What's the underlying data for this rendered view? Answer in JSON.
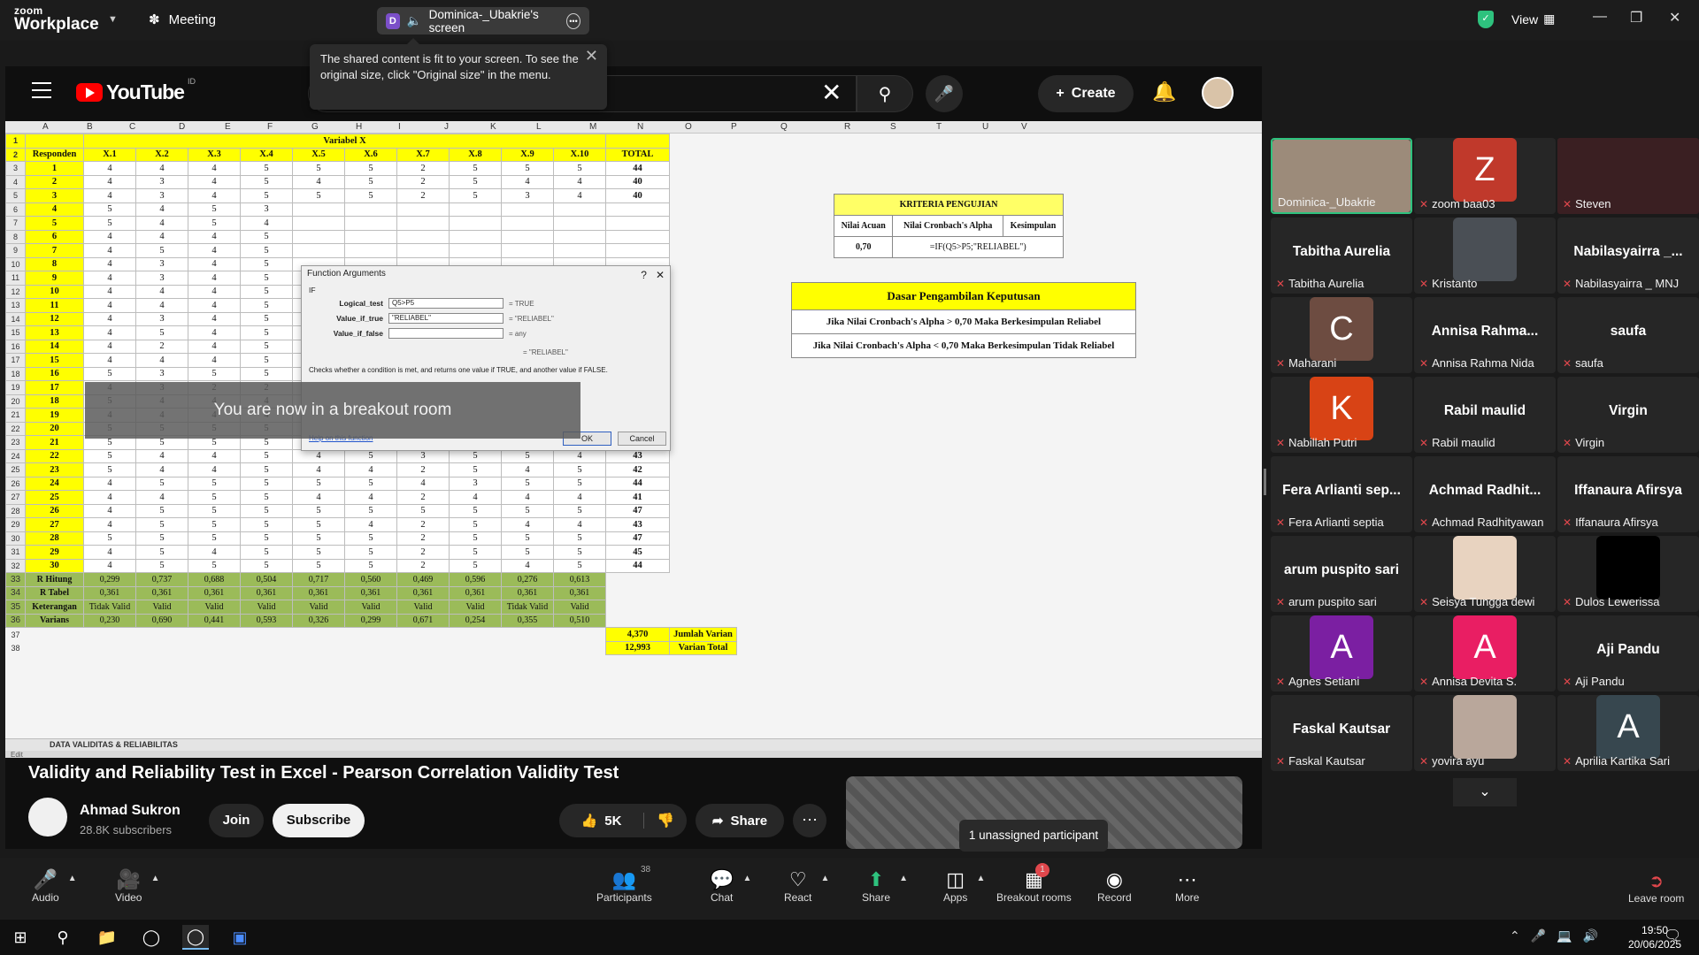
{
  "zoom": {
    "logo_top": "zoom",
    "logo_bottom": "Workplace",
    "meeting_label": "Meeting",
    "screen_pill_initial": "D",
    "screen_pill_label": "Dominica-_Ubakrie's screen",
    "tooltip_text": "The shared content is fit to your screen. To see the original size, click \"Original size\" in the menu.",
    "view_label": "View",
    "breakout_toast": "You are now in a breakout room",
    "unassigned": "1 unassigned participant"
  },
  "youtube": {
    "logo_text": "YouTube",
    "logo_region": "ID",
    "search_value": "uji validitas dan reliabilitas dengan excel",
    "create_label": "Create",
    "video_title": "Validity and Reliability Test in Excel - Pearson Correlation Validity Test",
    "channel_name": "Ahmad Sukron",
    "channel_subs": "28.8K subscribers",
    "join_label": "Join",
    "subscribe_label": "Subscribe",
    "likes": "5K",
    "share_label": "Share"
  },
  "sheet": {
    "columns": [
      "A",
      "B",
      "C",
      "D",
      "E",
      "F",
      "G",
      "H",
      "I",
      "J",
      "K",
      "L",
      "M",
      "N",
      "O",
      "P",
      "Q",
      "R",
      "S",
      "T",
      "U",
      "V"
    ],
    "variabel_header": "Variabel X",
    "headers": [
      "Responden",
      "X.1",
      "X.2",
      "X.3",
      "X.4",
      "X.5",
      "X.6",
      "X.7",
      "X.8",
      "X.9",
      "X.10",
      "TOTAL"
    ],
    "rows": [
      [
        "1",
        "4",
        "4",
        "4",
        "5",
        "5",
        "5",
        "2",
        "5",
        "5",
        "5",
        "44"
      ],
      [
        "2",
        "4",
        "3",
        "4",
        "5",
        "4",
        "5",
        "2",
        "5",
        "4",
        "4",
        "40"
      ],
      [
        "3",
        "4",
        "3",
        "4",
        "5",
        "5",
        "5",
        "2",
        "5",
        "3",
        "4",
        "40"
      ],
      [
        "4",
        "5",
        "4",
        "5",
        "3",
        "",
        "",
        "",
        "",
        "",
        "",
        ""
      ],
      [
        "5",
        "5",
        "4",
        "5",
        "4",
        "",
        "",
        "",
        "",
        "",
        "",
        ""
      ],
      [
        "6",
        "4",
        "4",
        "4",
        "5",
        "",
        "",
        "",
        "",
        "",
        "",
        ""
      ],
      [
        "7",
        "4",
        "5",
        "4",
        "5",
        "",
        "",
        "",
        "",
        "",
        "",
        ""
      ],
      [
        "8",
        "4",
        "3",
        "4",
        "5",
        "",
        "",
        "",
        "",
        "",
        "",
        ""
      ],
      [
        "9",
        "4",
        "3",
        "4",
        "5",
        "",
        "",
        "",
        "",
        "",
        "",
        ""
      ],
      [
        "10",
        "4",
        "4",
        "4",
        "5",
        "",
        "",
        "",
        "",
        "",
        "",
        ""
      ],
      [
        "11",
        "4",
        "4",
        "4",
        "5",
        "",
        "",
        "",
        "",
        "",
        "",
        ""
      ],
      [
        "12",
        "4",
        "3",
        "4",
        "5",
        "",
        "",
        "",
        "",
        "",
        "",
        ""
      ],
      [
        "13",
        "4",
        "5",
        "4",
        "5",
        "",
        "",
        "",
        "",
        "",
        "",
        ""
      ],
      [
        "14",
        "4",
        "2",
        "4",
        "5",
        "",
        "",
        "",
        "",
        "",
        "",
        ""
      ],
      [
        "15",
        "4",
        "4",
        "4",
        "5",
        "",
        "",
        "",
        "",
        "",
        "",
        ""
      ],
      [
        "16",
        "5",
        "3",
        "5",
        "5",
        "",
        "",
        "",
        "",
        "",
        "",
        ""
      ],
      [
        "17",
        "4",
        "3",
        "2",
        "2",
        "3",
        "4",
        "2",
        "4",
        "4",
        "2",
        "30"
      ],
      [
        "18",
        "5",
        "4",
        "4",
        "4",
        "4",
        "4",
        "2",
        "4",
        "4",
        "4",
        "39"
      ],
      [
        "19",
        "4",
        "4",
        "4",
        "4",
        "4",
        "3",
        "2",
        "4",
        "4",
        "5",
        "38"
      ],
      [
        "20",
        "5",
        "5",
        "5",
        "5",
        "5",
        "5",
        "4",
        "5",
        "4",
        "5",
        "44"
      ],
      [
        "21",
        "5",
        "5",
        "5",
        "5",
        "4",
        "5",
        "4",
        "5",
        "4",
        "5",
        "45"
      ],
      [
        "22",
        "5",
        "4",
        "4",
        "5",
        "4",
        "5",
        "3",
        "5",
        "5",
        "4",
        "43"
      ],
      [
        "23",
        "5",
        "4",
        "4",
        "5",
        "4",
        "4",
        "2",
        "5",
        "4",
        "5",
        "42"
      ],
      [
        "24",
        "4",
        "5",
        "5",
        "5",
        "5",
        "5",
        "4",
        "3",
        "5",
        "5",
        "44"
      ],
      [
        "25",
        "4",
        "4",
        "5",
        "5",
        "4",
        "4",
        "2",
        "4",
        "4",
        "4",
        "41"
      ],
      [
        "26",
        "4",
        "5",
        "5",
        "5",
        "5",
        "5",
        "5",
        "5",
        "5",
        "5",
        "47"
      ],
      [
        "27",
        "4",
        "5",
        "5",
        "5",
        "5",
        "4",
        "2",
        "5",
        "4",
        "4",
        "43"
      ],
      [
        "28",
        "5",
        "5",
        "5",
        "5",
        "5",
        "5",
        "2",
        "5",
        "5",
        "5",
        "47"
      ],
      [
        "29",
        "4",
        "5",
        "4",
        "5",
        "5",
        "5",
        "2",
        "5",
        "5",
        "5",
        "45"
      ],
      [
        "30",
        "4",
        "5",
        "5",
        "5",
        "5",
        "5",
        "2",
        "5",
        "4",
        "5",
        "44"
      ]
    ],
    "stats": [
      [
        "R Hitung",
        "0,299",
        "0,737",
        "0,688",
        "0,504",
        "0,717",
        "0,560",
        "0,469",
        "0,596",
        "0,276",
        "0,613"
      ],
      [
        "R Tabel",
        "0,361",
        "0,361",
        "0,361",
        "0,361",
        "0,361",
        "0,361",
        "0,361",
        "0,361",
        "0,361",
        "0,361"
      ],
      [
        "Keterangan",
        "Tidak Valid",
        "Valid",
        "Valid",
        "Valid",
        "Valid",
        "Valid",
        "Valid",
        "Valid",
        "Tidak Valid",
        "Valid"
      ],
      [
        "Varians",
        "0,230",
        "0,690",
        "0,441",
        "0,593",
        "0,326",
        "0,299",
        "0,671",
        "0,254",
        "0,355",
        "0,510"
      ]
    ],
    "jumlah_varian_value": "4,370",
    "jumlah_varian_label": "Jumlah Varian",
    "varian_total_value": "12,993",
    "varian_total_label": "Varian Total",
    "kriteria_title": "KRITERIA PENGUJIAN",
    "kriteria_headers": [
      "Nilai Acuan",
      "Nilai Cronbach's Alpha",
      "Kesimpulan"
    ],
    "kriteria_acuan": "0,70",
    "kriteria_formula": "=IF(Q5>P5;\"RELIABEL\")",
    "dasar_title": "Dasar Pengambilan Keputusan",
    "dasar_rule1": "Jika Nilai Cronbach's Alpha > 0,70 Maka Berkesimpulan Reliabel",
    "dasar_rule2": "Jika Nilai Cronbach's Alpha < 0,70 Maka Berkesimpulan Tidak Reliabel",
    "tab_name": "DATA VALIDITAS & RELIABILITAS",
    "status_text": "Edit"
  },
  "fn_dialog": {
    "title": "Function Arguments",
    "func": "IF",
    "logical_label": "Logical_test",
    "logical_value": "Q5>P5",
    "logical_result": "= TRUE",
    "true_label": "Value_if_true",
    "true_value": "\"RELIABEL\"",
    "true_result": "= \"RELIABEL\"",
    "false_label": "Value_if_false",
    "false_value": "",
    "false_result": "= any",
    "total_result": "= \"RELIABEL\"",
    "description": "Checks whether a condition is met, and returns one value if TRUE, and another value if FALSE.",
    "help_link": "Help on this function",
    "ok_label": "OK",
    "cancel_label": "Cancel"
  },
  "participants": [
    {
      "name": "Dominica-_Ubakrie",
      "display": "",
      "kind": "video",
      "color": "#9c8b7a",
      "active": true
    },
    {
      "name": "zoom baa03",
      "display": "",
      "kind": "avatar",
      "letter": "Z",
      "color": "#c0392b"
    },
    {
      "name": "Steven",
      "display": "",
      "kind": "video",
      "color": "#3a1f22"
    },
    {
      "name": "Tabitha Aurelia",
      "display": "Tabitha Aurelia",
      "kind": "name"
    },
    {
      "name": "Kristanto",
      "display": "",
      "kind": "photo",
      "color": "#4a4f55"
    },
    {
      "name": "Nabilasyairra _ MNJ",
      "display": "Nabilasyairra _...",
      "kind": "name"
    },
    {
      "name": "Maharani",
      "display": "",
      "kind": "avatar",
      "letter": "C",
      "color": "#6d4c41"
    },
    {
      "name": "Annisa Rahma Nida",
      "display": "Annisa Rahma...",
      "kind": "name"
    },
    {
      "name": "saufa",
      "display": "saufa",
      "kind": "name"
    },
    {
      "name": "Nabillah Putri",
      "display": "",
      "kind": "avatar",
      "letter": "K",
      "color": "#d84315"
    },
    {
      "name": "Rabil maulid",
      "display": "Rabil maulid",
      "kind": "name"
    },
    {
      "name": "Virgin",
      "display": "Virgin",
      "kind": "name"
    },
    {
      "name": "Fera Arlianti septia",
      "display": "Fera Arlianti sep...",
      "kind": "name"
    },
    {
      "name": "Achmad Radhityawan",
      "display": "Achmad Radhit...",
      "kind": "name"
    },
    {
      "name": "Iffanaura Afirsya",
      "display": "Iffanaura Afirsya",
      "kind": "name"
    },
    {
      "name": "arum puspito sari",
      "display": "arum puspito sari",
      "kind": "name"
    },
    {
      "name": "Seisya Tungga dewi",
      "display": "",
      "kind": "photo",
      "color": "#e8d3c0"
    },
    {
      "name": "Dulos Lewerissa",
      "display": "",
      "kind": "photo",
      "color": "#000000"
    },
    {
      "name": "Agnes Setiani",
      "display": "",
      "kind": "avatar",
      "letter": "A",
      "color": "#7b1fa2"
    },
    {
      "name": "Annisa Devita S.",
      "display": "",
      "kind": "avatar",
      "letter": "A",
      "color": "#e91e63"
    },
    {
      "name": "Aji Pandu",
      "display": "Aji Pandu",
      "kind": "name"
    },
    {
      "name": "Faskal Kautsar",
      "display": "Faskal Kautsar",
      "kind": "name"
    },
    {
      "name": "yovira ayu",
      "display": "",
      "kind": "photo",
      "color": "#b9a79b"
    },
    {
      "name": "Aprilia Kartika Sari",
      "display": "",
      "kind": "avatar",
      "letter": "A",
      "color": "#37474f"
    }
  ],
  "toolbar": {
    "audio": "Audio",
    "video": "Video",
    "participants": "Participants",
    "participants_count": "38",
    "chat": "Chat",
    "react": "React",
    "share": "Share",
    "apps": "Apps",
    "breakout": "Breakout rooms",
    "breakout_badge": "1",
    "record": "Record",
    "more": "More",
    "leave": "Leave room"
  },
  "taskbar": {
    "time": "19:50",
    "date": "20/06/2025",
    "notif_count": "1"
  }
}
